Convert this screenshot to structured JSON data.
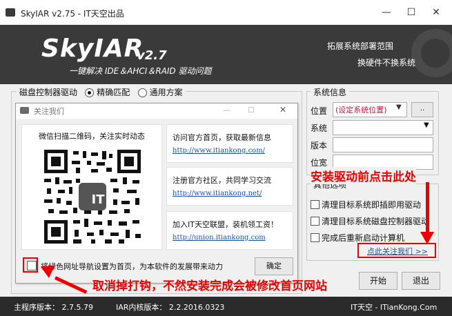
{
  "window": {
    "title": "SkyIAR v2.75 - IT天空出品",
    "minimize": "—",
    "maximize": "☐",
    "close": "✕"
  },
  "banner": {
    "logo": "SkyIAR",
    "version": "v2.7",
    "tagline": "一键解决 IDE＆AHCI＆RAID 驱动问题",
    "link1": "拓展系统部署范围",
    "link2": "换硬件不换系统"
  },
  "driver_group": {
    "label": "磁盘控制器驱动",
    "options": [
      "精确匹配",
      "通用方案"
    ],
    "selected": "精确匹配"
  },
  "dialog": {
    "title": "关注我们",
    "minimize": "—",
    "maximize": "☐",
    "close": "✕",
    "qr_title": "微信扫描二维码，关注实时动态",
    "qr_badge": "IT",
    "boxes": [
      {
        "title": "访问官方首页，获取最新信息",
        "link": "http://www.itiankong.com/"
      },
      {
        "title": "注册官方社区，共同学习交流",
        "link": "http://www.itiankong.net/"
      },
      {
        "title": "加入IT天空联盟，装机领工资！",
        "link": "http://union.itiankong.com"
      }
    ],
    "homepage_checkbox": "将绿色网址导航设置为首页，为本软件的发展带来动力",
    "ok_button": "确定"
  },
  "system_info": {
    "label": "系统信息",
    "position_label": "位置",
    "position_value": "(设定系统位置)",
    "browse_button": "..",
    "fields": [
      "系统",
      "版本",
      "位宽"
    ]
  },
  "options": {
    "label": "其他选项",
    "items": [
      "清理目标系统即插即用驱动",
      "清理目标系统磁盘控制器驱动",
      "完成后重新启动计算机"
    ],
    "follow_link": "点此关注我们 >>"
  },
  "buttons": {
    "next": "开始",
    "exit": "退出"
  },
  "annotations": {
    "top": "安装驱动前点击此处",
    "bottom": "取消掉打钩，不然安装完成会被修改首页网站"
  },
  "statusbar": {
    "main_version": "主程序版本： 2.7.5.79",
    "core_version": "IAR内核版本： 2.2.2016.0323",
    "site": "IT天空 - ITianKong.Com"
  },
  "colors": {
    "banner_bg": "#3a3a3a",
    "annotation_red": "#e00000",
    "link_blue": "#1a4fa0",
    "placeholder_red": "#d0103a",
    "statusbar_bg": "#2b2b2b"
  }
}
